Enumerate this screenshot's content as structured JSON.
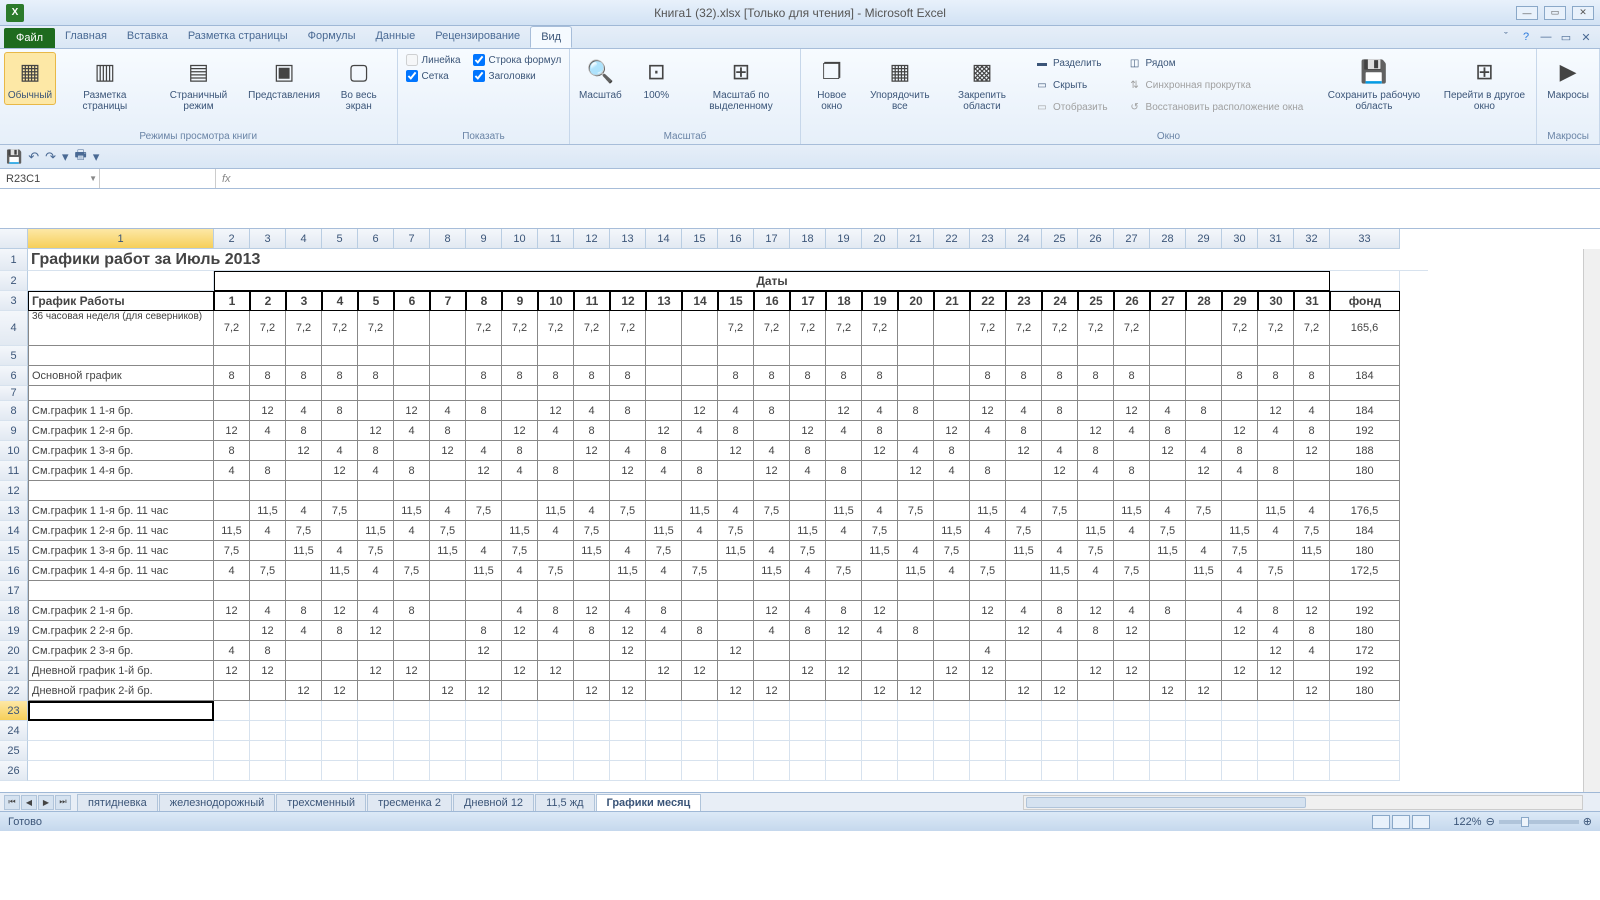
{
  "app_title": "Книга1 (32).xlsx  [Только для чтения]  -  Microsoft Excel",
  "file_tab": "Файл",
  "ribbon_tabs": [
    "Главная",
    "Вставка",
    "Разметка страницы",
    "Формулы",
    "Данные",
    "Рецензирование",
    "Вид"
  ],
  "active_tab": "Вид",
  "ribbon": {
    "views": {
      "label": "Режимы просмотра книги",
      "normal": "Обычный",
      "page_layout": "Разметка\nстраницы",
      "page_break": "Страничный\nрежим",
      "custom": "Представления",
      "fullscreen": "Во весь\nэкран"
    },
    "show": {
      "label": "Показать",
      "ruler": "Линейка",
      "formula_bar": "Строка формул",
      "gridlines": "Сетка",
      "headings": "Заголовки"
    },
    "zoom": {
      "label": "Масштаб",
      "zoom": "Масштаб",
      "z100": "100%",
      "sel": "Масштаб по\nвыделенному"
    },
    "window": {
      "label": "Окно",
      "new": "Новое\nокно",
      "arrange": "Упорядочить\nвсе",
      "freeze": "Закрепить\nобласти",
      "split": "Разделить",
      "hide": "Скрыть",
      "unhide": "Отобразить",
      "side": "Рядом",
      "sync": "Синхронная прокрутка",
      "reset": "Восстановить расположение окна",
      "save": "Сохранить\nрабочую область",
      "switch": "Перейти в\nдругое окно"
    },
    "macros": {
      "label": "Макросы",
      "macros": "Макросы"
    }
  },
  "namebox": "R23C1",
  "col_headers": [
    "1",
    "2",
    "3",
    "4",
    "5",
    "6",
    "7",
    "8",
    "9",
    "10",
    "11",
    "12",
    "13",
    "14",
    "15",
    "16",
    "17",
    "18",
    "19",
    "20",
    "21",
    "22",
    "23",
    "24",
    "25",
    "26",
    "27",
    "28",
    "29",
    "30",
    "31",
    "32",
    "33"
  ],
  "sheet_title": "Графики работ за Июль 2013",
  "daty": "Даты",
  "schedule_hdr": "График Работы",
  "fund": "фонд",
  "days": [
    "1",
    "2",
    "3",
    "4",
    "5",
    "6",
    "7",
    "8",
    "9",
    "10",
    "11",
    "12",
    "13",
    "14",
    "15",
    "16",
    "17",
    "18",
    "19",
    "20",
    "21",
    "22",
    "23",
    "24",
    "25",
    "26",
    "27",
    "28",
    "29",
    "30",
    "31"
  ],
  "rows": [
    {
      "name": "36 часовая неделя (для северников)",
      "v": [
        "7,2",
        "7,2",
        "7,2",
        "7,2",
        "7,2",
        "",
        "",
        "7,2",
        "7,2",
        "7,2",
        "7,2",
        "7,2",
        "",
        "",
        "7,2",
        "7,2",
        "7,2",
        "7,2",
        "7,2",
        "",
        "",
        "7,2",
        "7,2",
        "7,2",
        "7,2",
        "7,2",
        "",
        "",
        "7,2",
        "7,2",
        "7,2"
      ],
      "f": "165,6"
    },
    {
      "name": "",
      "v": [
        "",
        "",
        "",
        "",
        "",
        "",
        "",
        "",
        "",
        "",
        "",
        "",
        "",
        "",
        "",
        "",
        "",
        "",
        "",
        "",
        "",
        "",
        "",
        "",
        "",
        "",
        "",
        "",
        "",
        "",
        ""
      ],
      "f": ""
    },
    {
      "name": "Основной график",
      "v": [
        "8",
        "8",
        "8",
        "8",
        "8",
        "",
        "",
        "8",
        "8",
        "8",
        "8",
        "8",
        "",
        "",
        "8",
        "8",
        "8",
        "8",
        "8",
        "",
        "",
        "8",
        "8",
        "8",
        "8",
        "8",
        "",
        "",
        "8",
        "8",
        "8"
      ],
      "f": "184"
    },
    {
      "name": "",
      "v": [
        "",
        "",
        "",
        "",
        "",
        "",
        "",
        "",
        "",
        "",
        "",
        "",
        "",
        "",
        "",
        "",
        "",
        "",
        "",
        "",
        "",
        "",
        "",
        "",
        "",
        "",
        "",
        "",
        "",
        "",
        ""
      ],
      "f": "",
      "short": true
    },
    {
      "name": "См.график 1   1-я бр.",
      "v": [
        "",
        "12",
        "4",
        "8",
        "",
        "12",
        "4",
        "8",
        "",
        "12",
        "4",
        "8",
        "",
        "12",
        "4",
        "8",
        "",
        "12",
        "4",
        "8",
        "",
        "12",
        "4",
        "8",
        "",
        "12",
        "4",
        "8",
        "",
        "12",
        "4"
      ],
      "f": "184"
    },
    {
      "name": "См.график 1   2-я бр.",
      "v": [
        "12",
        "4",
        "8",
        "",
        "12",
        "4",
        "8",
        "",
        "12",
        "4",
        "8",
        "",
        "12",
        "4",
        "8",
        "",
        "12",
        "4",
        "8",
        "",
        "12",
        "4",
        "8",
        "",
        "12",
        "4",
        "8",
        "",
        "12",
        "4",
        "8"
      ],
      "f": "192"
    },
    {
      "name": "См.график 1   3-я бр.",
      "v": [
        "8",
        "",
        "12",
        "4",
        "8",
        "",
        "12",
        "4",
        "8",
        "",
        "12",
        "4",
        "8",
        "",
        "12",
        "4",
        "8",
        "",
        "12",
        "4",
        "8",
        "",
        "12",
        "4",
        "8",
        "",
        "12",
        "4",
        "8",
        "",
        "12"
      ],
      "f": "188"
    },
    {
      "name": "См.график 1   4-я бр.",
      "v": [
        "4",
        "8",
        "",
        "12",
        "4",
        "8",
        "",
        "12",
        "4",
        "8",
        "",
        "12",
        "4",
        "8",
        "",
        "12",
        "4",
        "8",
        "",
        "12",
        "4",
        "8",
        "",
        "12",
        "4",
        "8",
        "",
        "12",
        "4",
        "8",
        ""
      ],
      "f": "180"
    },
    {
      "name": "",
      "v": [
        "",
        "",
        "",
        "",
        "",
        "",
        "",
        "",
        "",
        "",
        "",
        "",
        "",
        "",
        "",
        "",
        "",
        "",
        "",
        "",
        "",
        "",
        "",
        "",
        "",
        "",
        "",
        "",
        "",
        "",
        ""
      ],
      "f": ""
    },
    {
      "name": "См.график 1   1-я бр. 11 час",
      "v": [
        "",
        "11,5",
        "4",
        "7,5",
        "",
        "11,5",
        "4",
        "7,5",
        "",
        "11,5",
        "4",
        "7,5",
        "",
        "11,5",
        "4",
        "7,5",
        "",
        "11,5",
        "4",
        "7,5",
        "",
        "11,5",
        "4",
        "7,5",
        "",
        "11,5",
        "4",
        "7,5",
        "",
        "11,5",
        "4"
      ],
      "f": "176,5"
    },
    {
      "name": "См.график 1   2-я бр. 11 час",
      "v": [
        "11,5",
        "4",
        "7,5",
        "",
        "11,5",
        "4",
        "7,5",
        "",
        "11,5",
        "4",
        "7,5",
        "",
        "11,5",
        "4",
        "7,5",
        "",
        "11,5",
        "4",
        "7,5",
        "",
        "11,5",
        "4",
        "7,5",
        "",
        "11,5",
        "4",
        "7,5",
        "",
        "11,5",
        "4",
        "7,5"
      ],
      "f": "184"
    },
    {
      "name": "См.график 1   3-я бр. 11 час",
      "v": [
        "7,5",
        "",
        "11,5",
        "4",
        "7,5",
        "",
        "11,5",
        "4",
        "7,5",
        "",
        "11,5",
        "4",
        "7,5",
        "",
        "11,5",
        "4",
        "7,5",
        "",
        "11,5",
        "4",
        "7,5",
        "",
        "11,5",
        "4",
        "7,5",
        "",
        "11,5",
        "4",
        "7,5",
        "",
        "11,5"
      ],
      "f": "180"
    },
    {
      "name": "См.график 1   4-я бр. 11 час",
      "v": [
        "4",
        "7,5",
        "",
        "11,5",
        "4",
        "7,5",
        "",
        "11,5",
        "4",
        "7,5",
        "",
        "11,5",
        "4",
        "7,5",
        "",
        "11,5",
        "4",
        "7,5",
        "",
        "11,5",
        "4",
        "7,5",
        "",
        "11,5",
        "4",
        "7,5",
        "",
        "11,5",
        "4",
        "7,5",
        ""
      ],
      "f": "172,5"
    },
    {
      "name": "",
      "v": [
        "",
        "",
        "",
        "",
        "",
        "",
        "",
        "",
        "",
        "",
        "",
        "",
        "",
        "",
        "",
        "",
        "",
        "",
        "",
        "",
        "",
        "",
        "",
        "",
        "",
        "",
        "",
        "",
        "",
        "",
        ""
      ],
      "f": ""
    },
    {
      "name": "См.график 2   1-я бр.",
      "v": [
        "12",
        "4",
        "8",
        "12",
        "4",
        "8",
        "",
        "",
        "4",
        "8",
        "12",
        "4",
        "8",
        "",
        "",
        "12",
        "4",
        "8",
        "12",
        "",
        "",
        "12",
        "4",
        "8",
        "12",
        "4",
        "8",
        "",
        "4",
        "8",
        "12"
      ],
      "f": "192"
    },
    {
      "name": "См.график 2   2-я бр.",
      "v": [
        "",
        "12",
        "4",
        "8",
        "12",
        "",
        "",
        "8",
        "12",
        "4",
        "8",
        "12",
        "4",
        "8",
        "",
        "4",
        "8",
        "12",
        "4",
        "8",
        "",
        "",
        "12",
        "4",
        "8",
        "12",
        "",
        "",
        "12",
        "4",
        "8"
      ],
      "f": "180"
    },
    {
      "name": "См.график 2   3-я бр.",
      "v": [
        "4",
        "8",
        "",
        "",
        "",
        "",
        "",
        "12",
        "",
        "",
        "",
        "12",
        "",
        "",
        "12",
        "",
        "",
        "",
        "",
        "",
        "",
        "4",
        "",
        "",
        "",
        "",
        "",
        "",
        "",
        "12",
        "4"
      ],
      "f": "172"
    },
    {
      "name": "Дневной график 1-й бр.",
      "v": [
        "12",
        "12",
        "",
        "",
        "12",
        "12",
        "",
        "",
        "12",
        "12",
        "",
        "",
        "12",
        "12",
        "",
        "",
        "12",
        "12",
        "",
        "",
        "12",
        "12",
        "",
        "",
        "12",
        "12",
        "",
        "",
        "12",
        "12",
        ""
      ],
      "f": "192"
    },
    {
      "name": "Дневной график 2-й бр.",
      "v": [
        "",
        "",
        "12",
        "12",
        "",
        "",
        "12",
        "12",
        "",
        "",
        "12",
        "12",
        "",
        "",
        "12",
        "12",
        "",
        "",
        "12",
        "12",
        "",
        "",
        "12",
        "12",
        "",
        "",
        "12",
        "12",
        "",
        "",
        "12"
      ],
      "f": "180"
    }
  ],
  "sheet_tabs": [
    "пятидневка",
    "железнодорожный",
    "трехсменный",
    "тресменка 2",
    "Дневной 12",
    "11,5 жд",
    "Графики месяц"
  ],
  "active_sheet": "Графики месяц",
  "status_text": "Готово",
  "zoom": "122%"
}
